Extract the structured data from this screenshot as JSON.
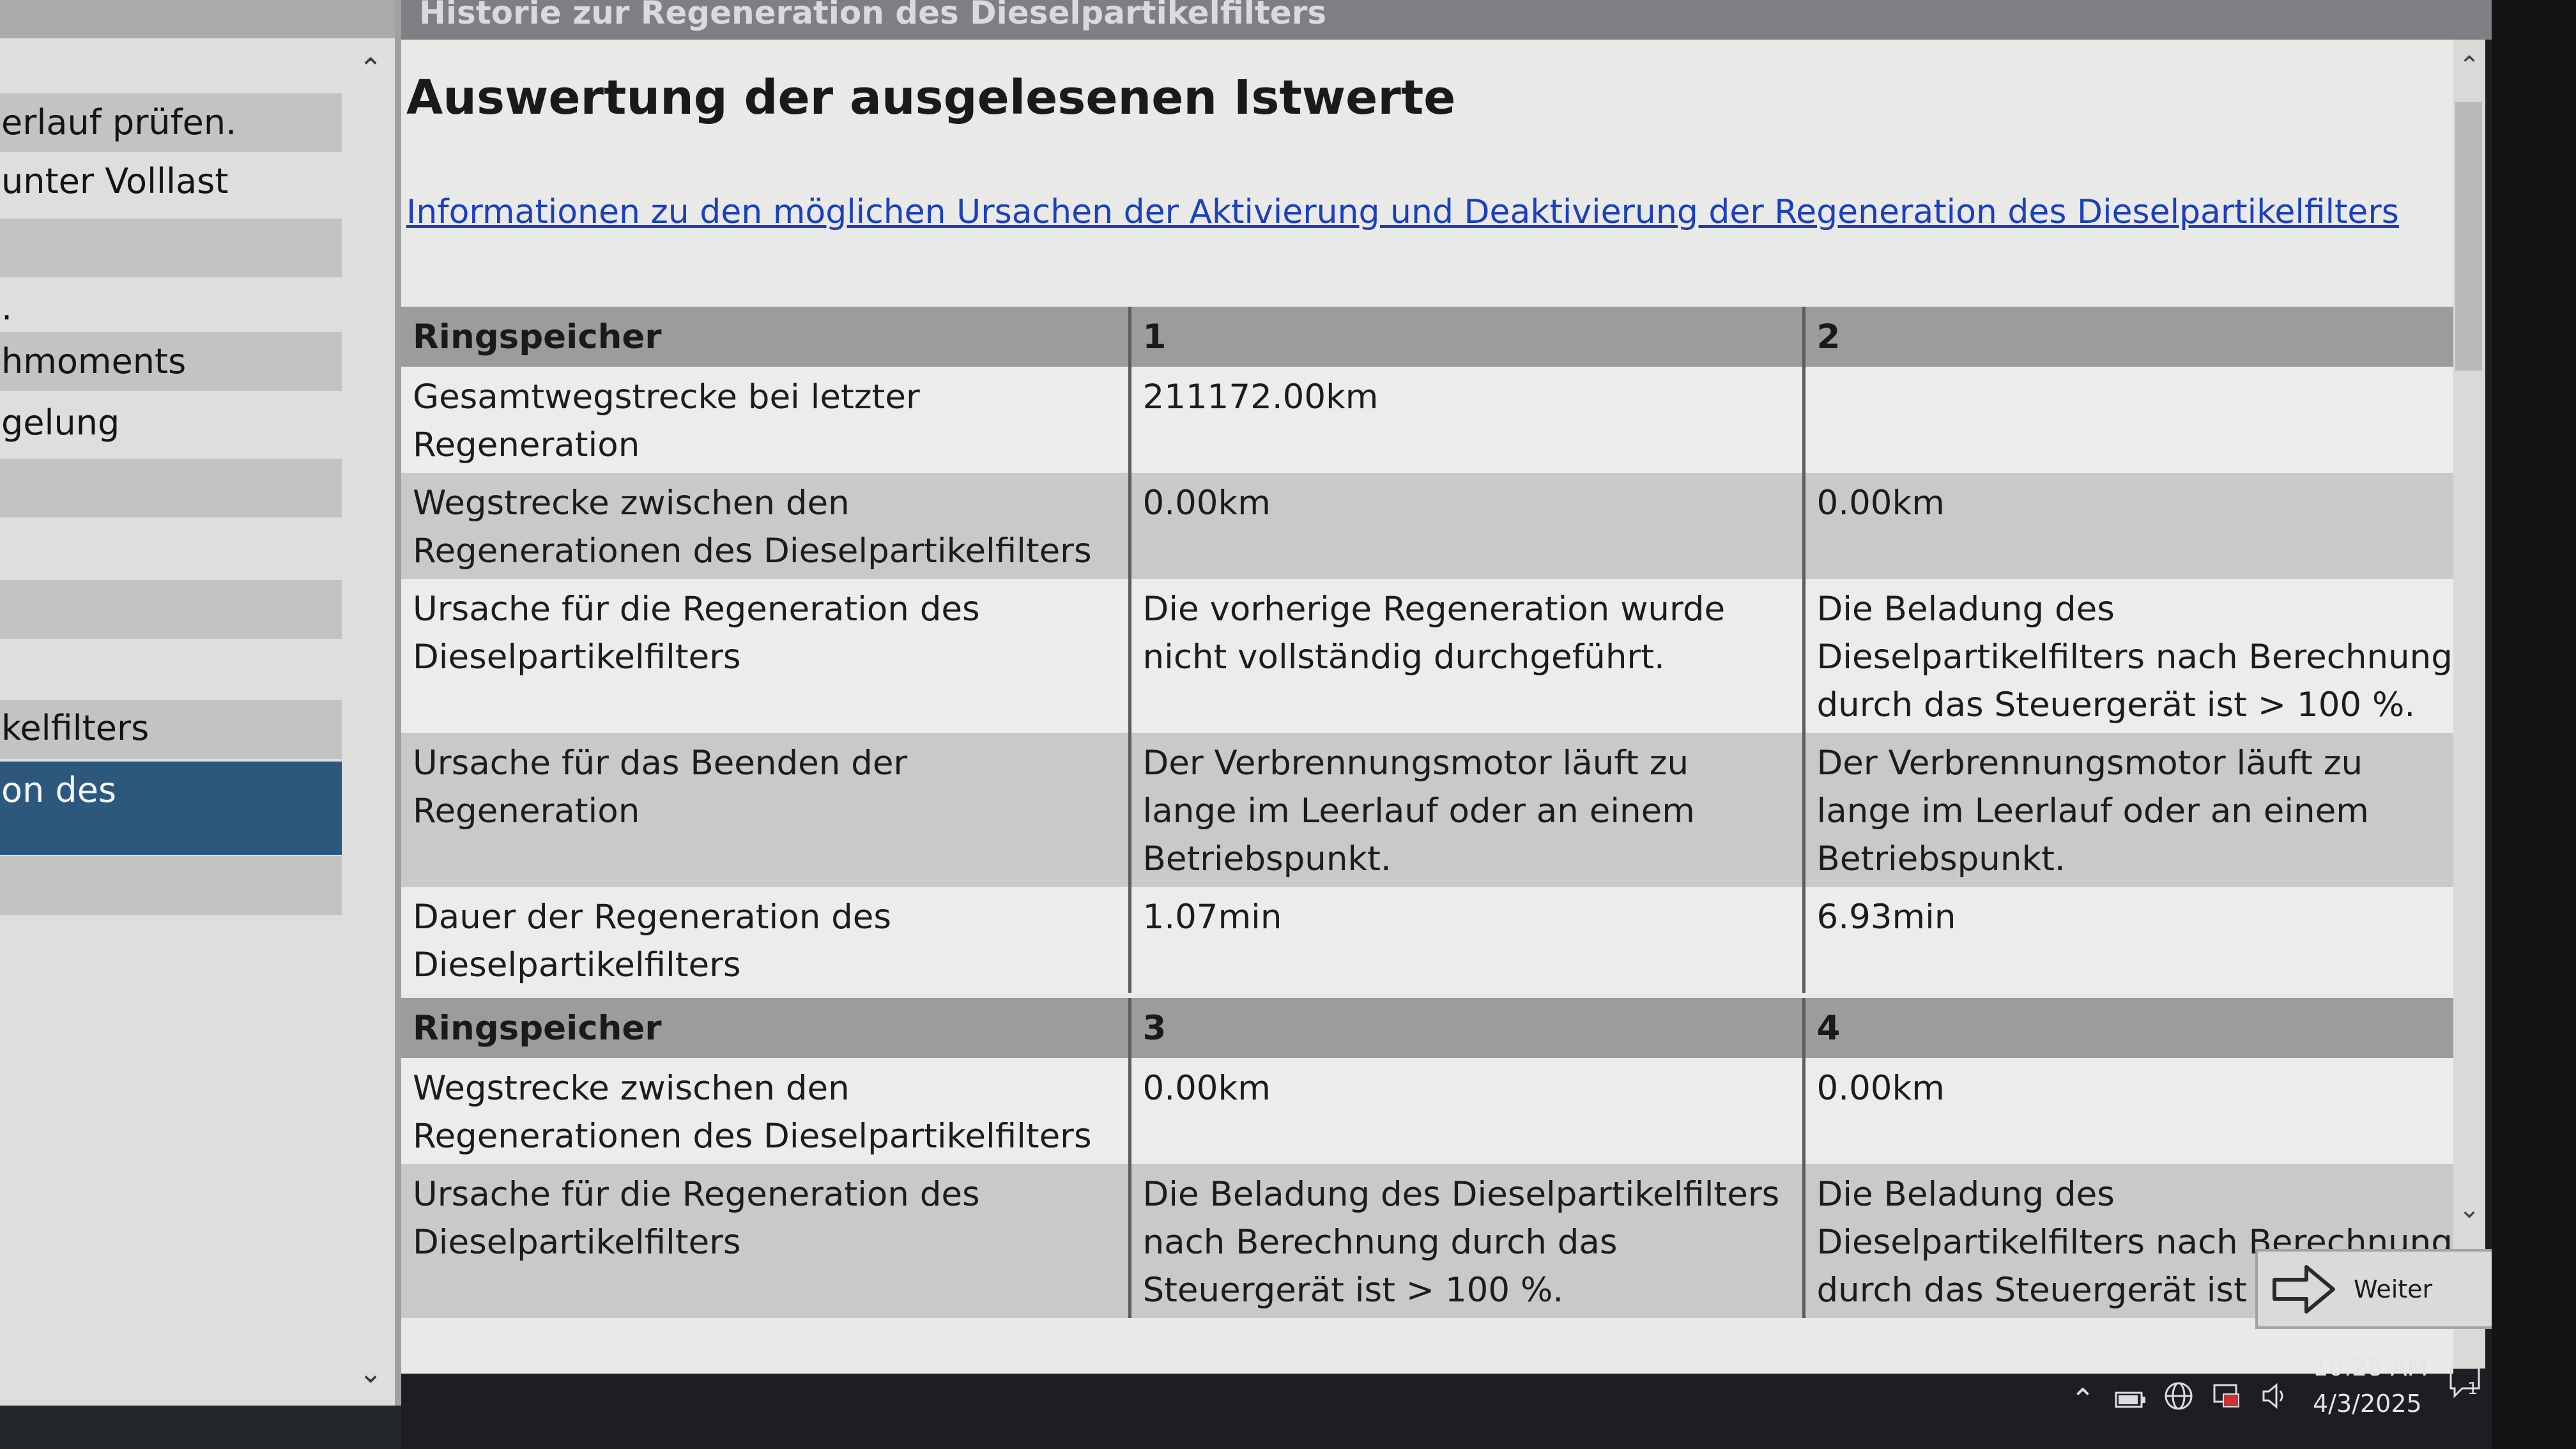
{
  "window": {
    "title": "Historie zur Regeneration des Dieselpartikelfilters"
  },
  "sidebar": {
    "items": [
      {
        "label": "erlauf prüfen."
      },
      {
        "label": "unter Volllast"
      },
      {
        "label": ""
      },
      {
        "label": "."
      },
      {
        "label": "hmoments"
      },
      {
        "label": "gelung"
      },
      {
        "label": ""
      },
      {
        "label": ""
      },
      {
        "label": ""
      },
      {
        "label": ""
      },
      {
        "label": ""
      },
      {
        "label": "kelfilters"
      },
      {
        "label": "on des"
      },
      {
        "label": ""
      }
    ],
    "scroll_up_icon": "chevron-up-icon",
    "scroll_down_icon": "chevron-down-icon"
  },
  "main": {
    "page_title": "Auswertung der ausgelesenen Istwerte",
    "info_link": "Informationen zu den möglichen Ursachen der Aktivierung und Deaktivierung der Regeneration des Dieselpartikelfilters",
    "table1": {
      "header": [
        "Ringspeicher",
        "1",
        "2"
      ],
      "rows": [
        [
          "Gesamtwegstrecke bei letzter Regeneration",
          "211172.00km",
          ""
        ],
        [
          "Wegstrecke zwischen den Regenerationen des Dieselpartikelfilters",
          "0.00km",
          "0.00km"
        ],
        [
          "Ursache für die Regeneration des Dieselpartikelfilters",
          "Die vorherige Regeneration wurde nicht vollständig durchgeführt.",
          "Die Beladung des Dieselpartikelfilters nach Berechnung durch das Steuergerät ist > 100 %."
        ],
        [
          "Ursache für das Beenden der Regeneration",
          "Der Verbrennungsmotor läuft zu lange im Leerlauf oder an einem Betriebspunkt.",
          "Der Verbrennungsmotor läuft zu lange im Leerlauf oder an einem Betriebspunkt."
        ],
        [
          "Dauer der Regeneration des Dieselpartikelfilters",
          "1.07min",
          "6.93min"
        ]
      ]
    },
    "table2": {
      "header": [
        "Ringspeicher",
        "3",
        "4"
      ],
      "rows": [
        [
          "Wegstrecke zwischen den Regenerationen des Dieselpartikelfilters",
          "0.00km",
          "0.00km"
        ],
        [
          "Ursache für die Regeneration des Dieselpartikelfilters",
          "Die Beladung des Dieselpartikelfilters nach Berechnung durch das Steuergerät ist > 100 %.",
          "Die Beladung des Dieselpartikelfilters nach Berechnung durch das Steuergerät ist > 100 %."
        ]
      ]
    }
  },
  "buttons": {
    "next_label": "Weiter",
    "next_icon": "arrow-right-icon"
  },
  "taskbar": {
    "time": "10:28 AM",
    "date": "4/3/2025",
    "notification_count": "1",
    "tray_icons": [
      "chevron-up-icon",
      "battery-icon",
      "globe-icon",
      "network-icon",
      "volume-icon",
      "notification-icon"
    ]
  },
  "colors": {
    "selected_item": "#2d587d",
    "link": "#1c3fbf",
    "table_header": "#9c9d9b"
  }
}
